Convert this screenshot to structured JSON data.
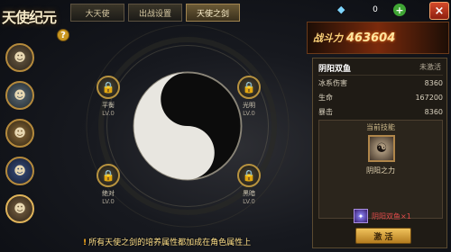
{
  "game_logo": "天使纪元",
  "tabs": [
    {
      "label": "大天使",
      "active": false
    },
    {
      "label": "出战设置",
      "active": false
    },
    {
      "label": "天使之剑",
      "active": true
    }
  ],
  "help_button": "?",
  "top_bar": {
    "diamond_count": "0",
    "add_label": "+",
    "close_label": "×"
  },
  "power": {
    "label": "战斗力",
    "value": "463604"
  },
  "slots": [
    {
      "name": "平衡",
      "level": "LV.0"
    },
    {
      "name": "光明",
      "level": "LV.0"
    },
    {
      "name": "绝对",
      "level": "LV.0"
    },
    {
      "name": "黑暗",
      "level": "LV.0"
    }
  ],
  "skill_panel": {
    "name": "阴阳双鱼",
    "state": "未激活",
    "stats": [
      {
        "label": "冰系伤害",
        "value": "8360"
      },
      {
        "label": "生命",
        "value": "167200"
      },
      {
        "label": "暴击",
        "value": "8360"
      }
    ],
    "current_skill_title": "当前技能",
    "current_skill_name": "阴阳之力",
    "item_label": "阴阳双鱼×1",
    "activate_label": "激 活"
  },
  "tip": {
    "icon": "!",
    "text": "所有天使之剑的培养属性都加成在角色属性上"
  },
  "colors": {
    "accent_gold": "#b7923f",
    "power_text": "#ffe6a0",
    "item_red": "#e04a4a"
  }
}
